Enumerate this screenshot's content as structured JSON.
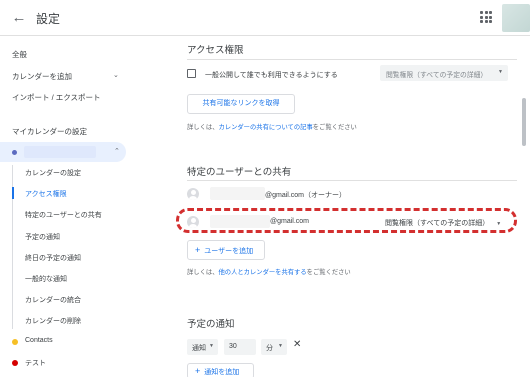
{
  "header": {
    "back_icon": "arrow-left-icon",
    "title": "設定",
    "apps_icon": "apps-grid-icon"
  },
  "sidebar": {
    "general": "全般",
    "add_calendar": "カレンダーを追加",
    "import_export": "インポート / エクスポート",
    "my_calendar_settings": "マイカレンダーの設定",
    "sub_items": [
      "カレンダーの設定",
      "アクセス権限",
      "特定のユーザーとの共有",
      "予定の通知",
      "終日の予定の通知",
      "一般的な通知",
      "カレンダーの統合",
      "カレンダーの削除"
    ],
    "active_sub_index": 1,
    "calendars": [
      {
        "label": "Contacts",
        "color": "#f6bf26"
      },
      {
        "label": "テスト",
        "color": "#d50000"
      }
    ],
    "my_calendar_color": "#5c6bc0"
  },
  "access": {
    "title": "アクセス権限",
    "public_label": "一般公開して誰でも利用できるようにする",
    "public_select": "閲覧権限（すべての予定の詳細）",
    "share_link_button": "共有可能なリンクを取得",
    "help_prefix": "詳しくは、",
    "help_link": "カレンダーの共有についての記事",
    "help_suffix": "をご覧ください"
  },
  "sharing": {
    "title": "特定のユーザーとの共有",
    "owner_email": "@gmail.com（オーナー）",
    "user_email": "@gmail.com",
    "user_permission": "閲覧権限（すべての予定の詳細）",
    "add_user_button": "ユーザーを追加",
    "help_prefix": "詳しくは、",
    "help_link": "他の人とカレンダーを共有する",
    "help_suffix": "をご覧ください"
  },
  "notifications": {
    "title": "予定の通知",
    "type": "通知",
    "amount": "30",
    "unit": "分",
    "add_button": "通知を追加"
  },
  "colors": {
    "accent": "#1a73e8",
    "highlight": "#d32f2f"
  }
}
